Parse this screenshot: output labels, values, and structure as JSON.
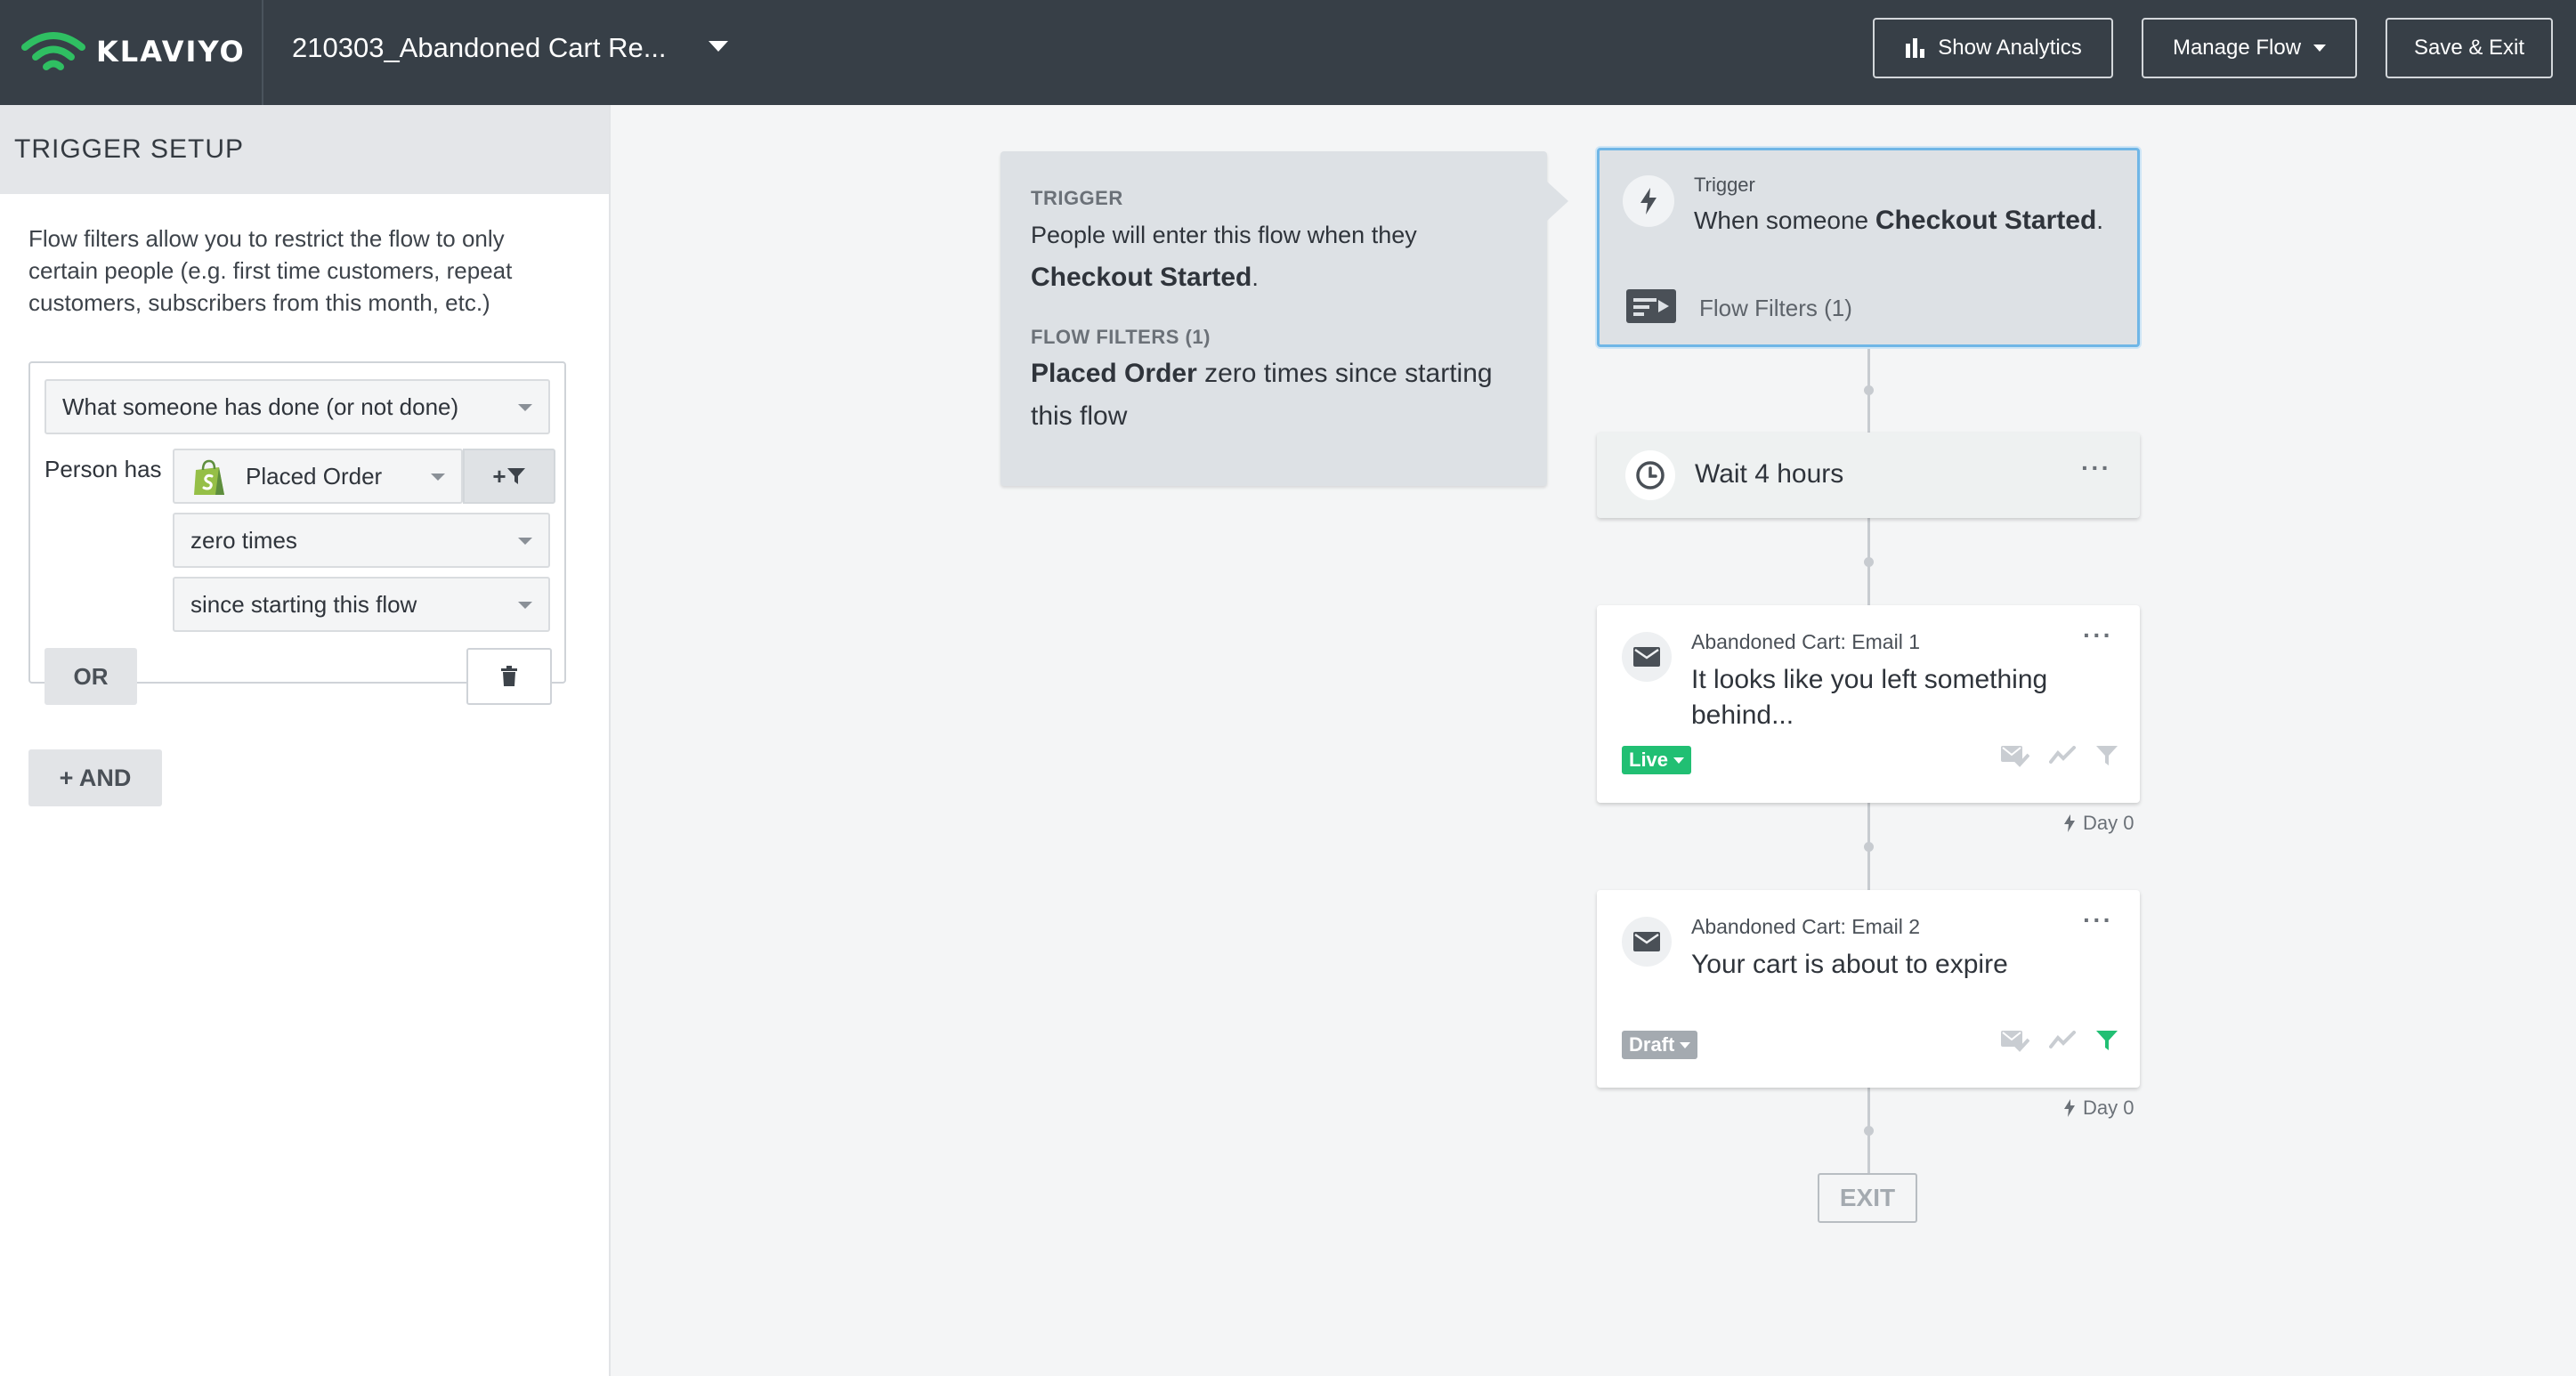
{
  "app": {
    "brand": "KLAVIYO",
    "flow_title": "210303_Abandoned Cart Re..."
  },
  "toolbar": {
    "analytics_label": "Show Analytics",
    "manage_label": "Manage Flow",
    "save_label": "Save & Exit"
  },
  "sidebar": {
    "header": "TRIGGER SETUP",
    "description": "Flow filters allow you to restrict the flow to only certain people (e.g. first time customers, repeat customers, subscribers from this month, etc.)",
    "filter": {
      "condition_type": "What someone has done (or not done)",
      "person_has_label": "Person has",
      "event": "Placed Order",
      "add_filter_label": "+",
      "frequency": "zero times",
      "timeframe": "since starting this flow",
      "or_label": "OR"
    },
    "and_label": "+ AND"
  },
  "summary": {
    "trigger_label": "TRIGGER",
    "trigger_text": "People will enter this flow when they",
    "trigger_metric": "Checkout Started",
    "period": ".",
    "filters_label": "FLOW FILTERS (1)",
    "filter_metric": "Placed Order",
    "filter_rest": "zero times since starting this flow"
  },
  "flow": {
    "trigger": {
      "label": "Trigger",
      "text": "When someone",
      "metric": "Checkout Started",
      "period": ".",
      "filters": "Flow Filters (1)"
    },
    "wait": {
      "text": "Wait 4 hours",
      "more": "···"
    },
    "emails": [
      {
        "label": "Abandoned Cart: Email 1",
        "subject": "It looks like you left something behind...",
        "status": "Live",
        "day": "Day 0",
        "more": "···"
      },
      {
        "label": "Abandoned Cart: Email 2",
        "subject": "Your cart is about to expire",
        "status": "Draft",
        "day": "Day 0",
        "more": "···"
      }
    ],
    "exit_label": "EXIT"
  },
  "colors": {
    "topbar": "#373f47",
    "live": "#21bf73",
    "draft": "#a4aab0",
    "selected_border": "#6fb6e6",
    "filter_active": "#21bf73"
  }
}
